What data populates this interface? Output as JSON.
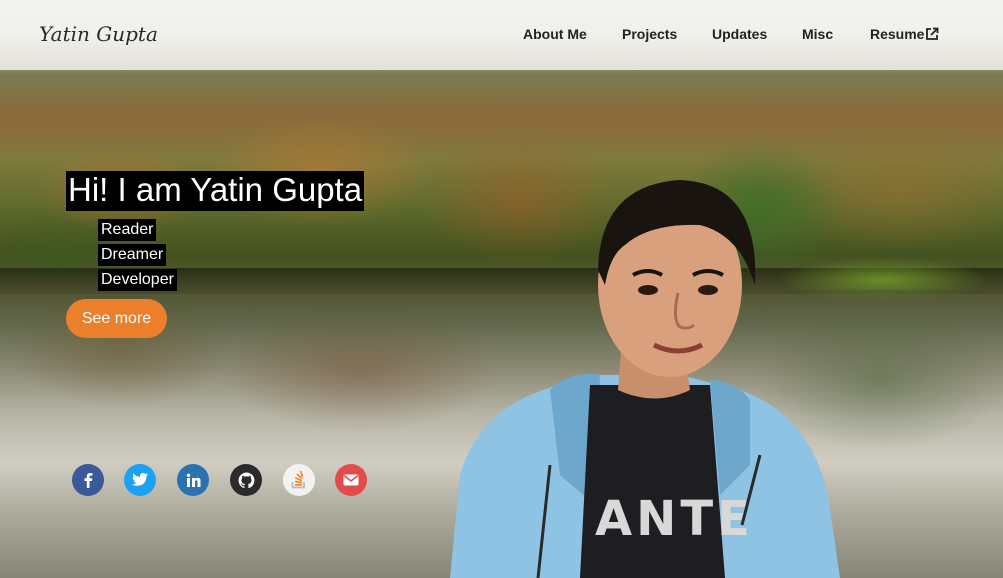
{
  "nav": {
    "brand": "Yatin Gupta",
    "items": [
      {
        "label": "About Me"
      },
      {
        "label": "Projects"
      },
      {
        "label": "Updates"
      },
      {
        "label": "Misc"
      },
      {
        "label": "Resume"
      }
    ]
  },
  "hero": {
    "headline": "Hi! I am Yatin Gupta",
    "roles": [
      "Reader",
      "Dreamer",
      "Developer"
    ],
    "cta_label": "See more"
  },
  "socials": [
    {
      "icon": "facebook-icon"
    },
    {
      "icon": "twitter-icon"
    },
    {
      "icon": "linkedin-icon"
    },
    {
      "icon": "github-icon"
    },
    {
      "icon": "stackoverflow-icon"
    },
    {
      "icon": "email-icon"
    }
  ],
  "colors": {
    "accent": "#ec7f2c",
    "facebook": "#3b5998",
    "twitter": "#1da1f2",
    "linkedin": "#2c72b1",
    "github": "#2b2b2b",
    "email": "#e34b4b"
  }
}
